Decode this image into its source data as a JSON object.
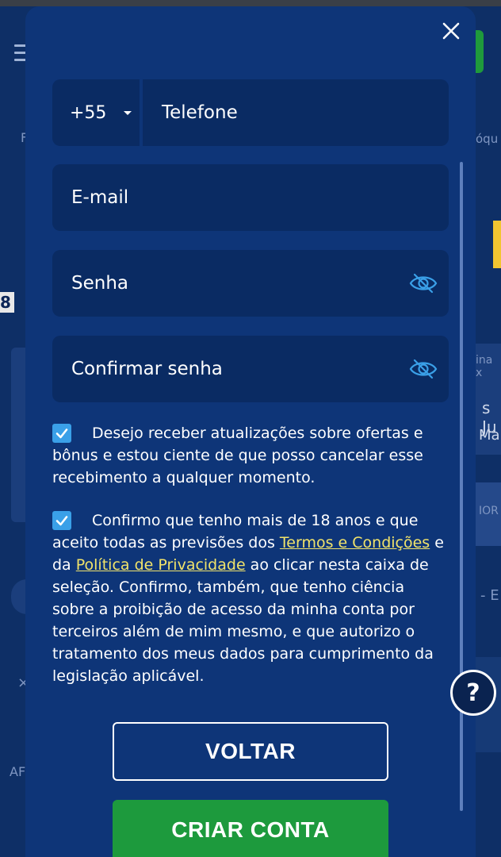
{
  "form": {
    "phone_code": "+55",
    "phone_placeholder": "Telefone",
    "email_placeholder": "E-mail",
    "password_placeholder": "Senha",
    "confirm_password_placeholder": "Confirmar senha"
  },
  "consent": {
    "offers_checked": true,
    "offers_text": "Desejo receber atualizações sobre ofertas e bônus e estou ciente de que posso cancelar esse recebimento a qualquer momento.",
    "terms_checked": true,
    "terms_text_1": "Confirmo que tenho mais de 18 anos e que aceito todas as previsões dos ",
    "terms_link": "Termos e Condições",
    "terms_text_2": " e da ",
    "privacy_link": "Política de Privacidade",
    "terms_text_3": " ao clicar nesta caixa de seleção. Confirmo, também, que tenho ciência sobre a proibição de acesso da minha conta por terceiros além de mim mesmo, e que autorizo o tratamento dos meus dados para cumprimento da legislação aplicável."
  },
  "buttons": {
    "back_label": "VOLTAR",
    "create_label": "CRIAR CONTA"
  },
  "help": {
    "label": "?"
  },
  "background": {
    "text_1": "F",
    "text_2": "óqu",
    "text_3": "8",
    "text_4": "ina x",
    "text_5": "s Ju",
    "text_6": "Ma",
    "text_7": "IOR",
    "text_8": "- E",
    "text_9": "AF",
    "text_10": "×"
  },
  "colors": {
    "modal_bg": "#0e3578",
    "field_bg": "#0a2b63",
    "checkbox": "#3aa0e8",
    "link": "#f1e36a",
    "primary_button": "#1d9a3d"
  }
}
